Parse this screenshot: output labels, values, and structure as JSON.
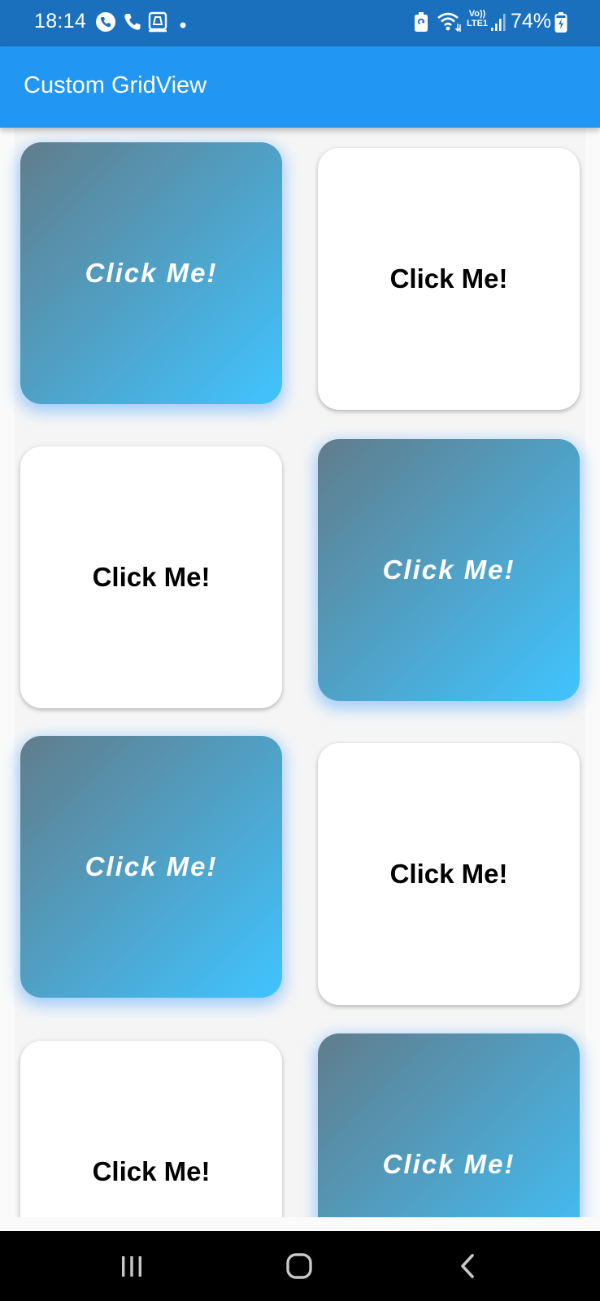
{
  "status_bar": {
    "time": "18:14",
    "battery_percent": "74%",
    "network_label_top": "Vo))",
    "network_label_bottom": "LTE1",
    "icons": [
      "whatsapp-call-icon",
      "phone-icon",
      "screen-cast-icon",
      "notification-dot-icon",
      "battery-saver-icon",
      "wifi-icon",
      "volte-lte-icon",
      "signal-icon",
      "battery-charging-icon"
    ]
  },
  "app_bar": {
    "title": "Custom GridView"
  },
  "grid": {
    "items": [
      {
        "label": "Click Me!",
        "style": "gradient"
      },
      {
        "label": "Click Me!",
        "style": "white"
      },
      {
        "label": "Click Me!",
        "style": "white"
      },
      {
        "label": "Click Me!",
        "style": "gradient"
      },
      {
        "label": "Click Me!",
        "style": "gradient"
      },
      {
        "label": "Click Me!",
        "style": "white"
      },
      {
        "label": "Click Me!",
        "style": "white"
      },
      {
        "label": "Click Me!",
        "style": "gradient"
      }
    ]
  },
  "nav_bar": {
    "buttons": [
      "recent-apps-icon",
      "home-icon",
      "back-icon"
    ]
  },
  "colors": {
    "status_bar": "#1a70bd",
    "app_bar": "#2196f3",
    "gradient_start": "#607d8b",
    "gradient_end": "#40c4ff",
    "background": "#fafafa",
    "nav_bar": "#000000"
  }
}
